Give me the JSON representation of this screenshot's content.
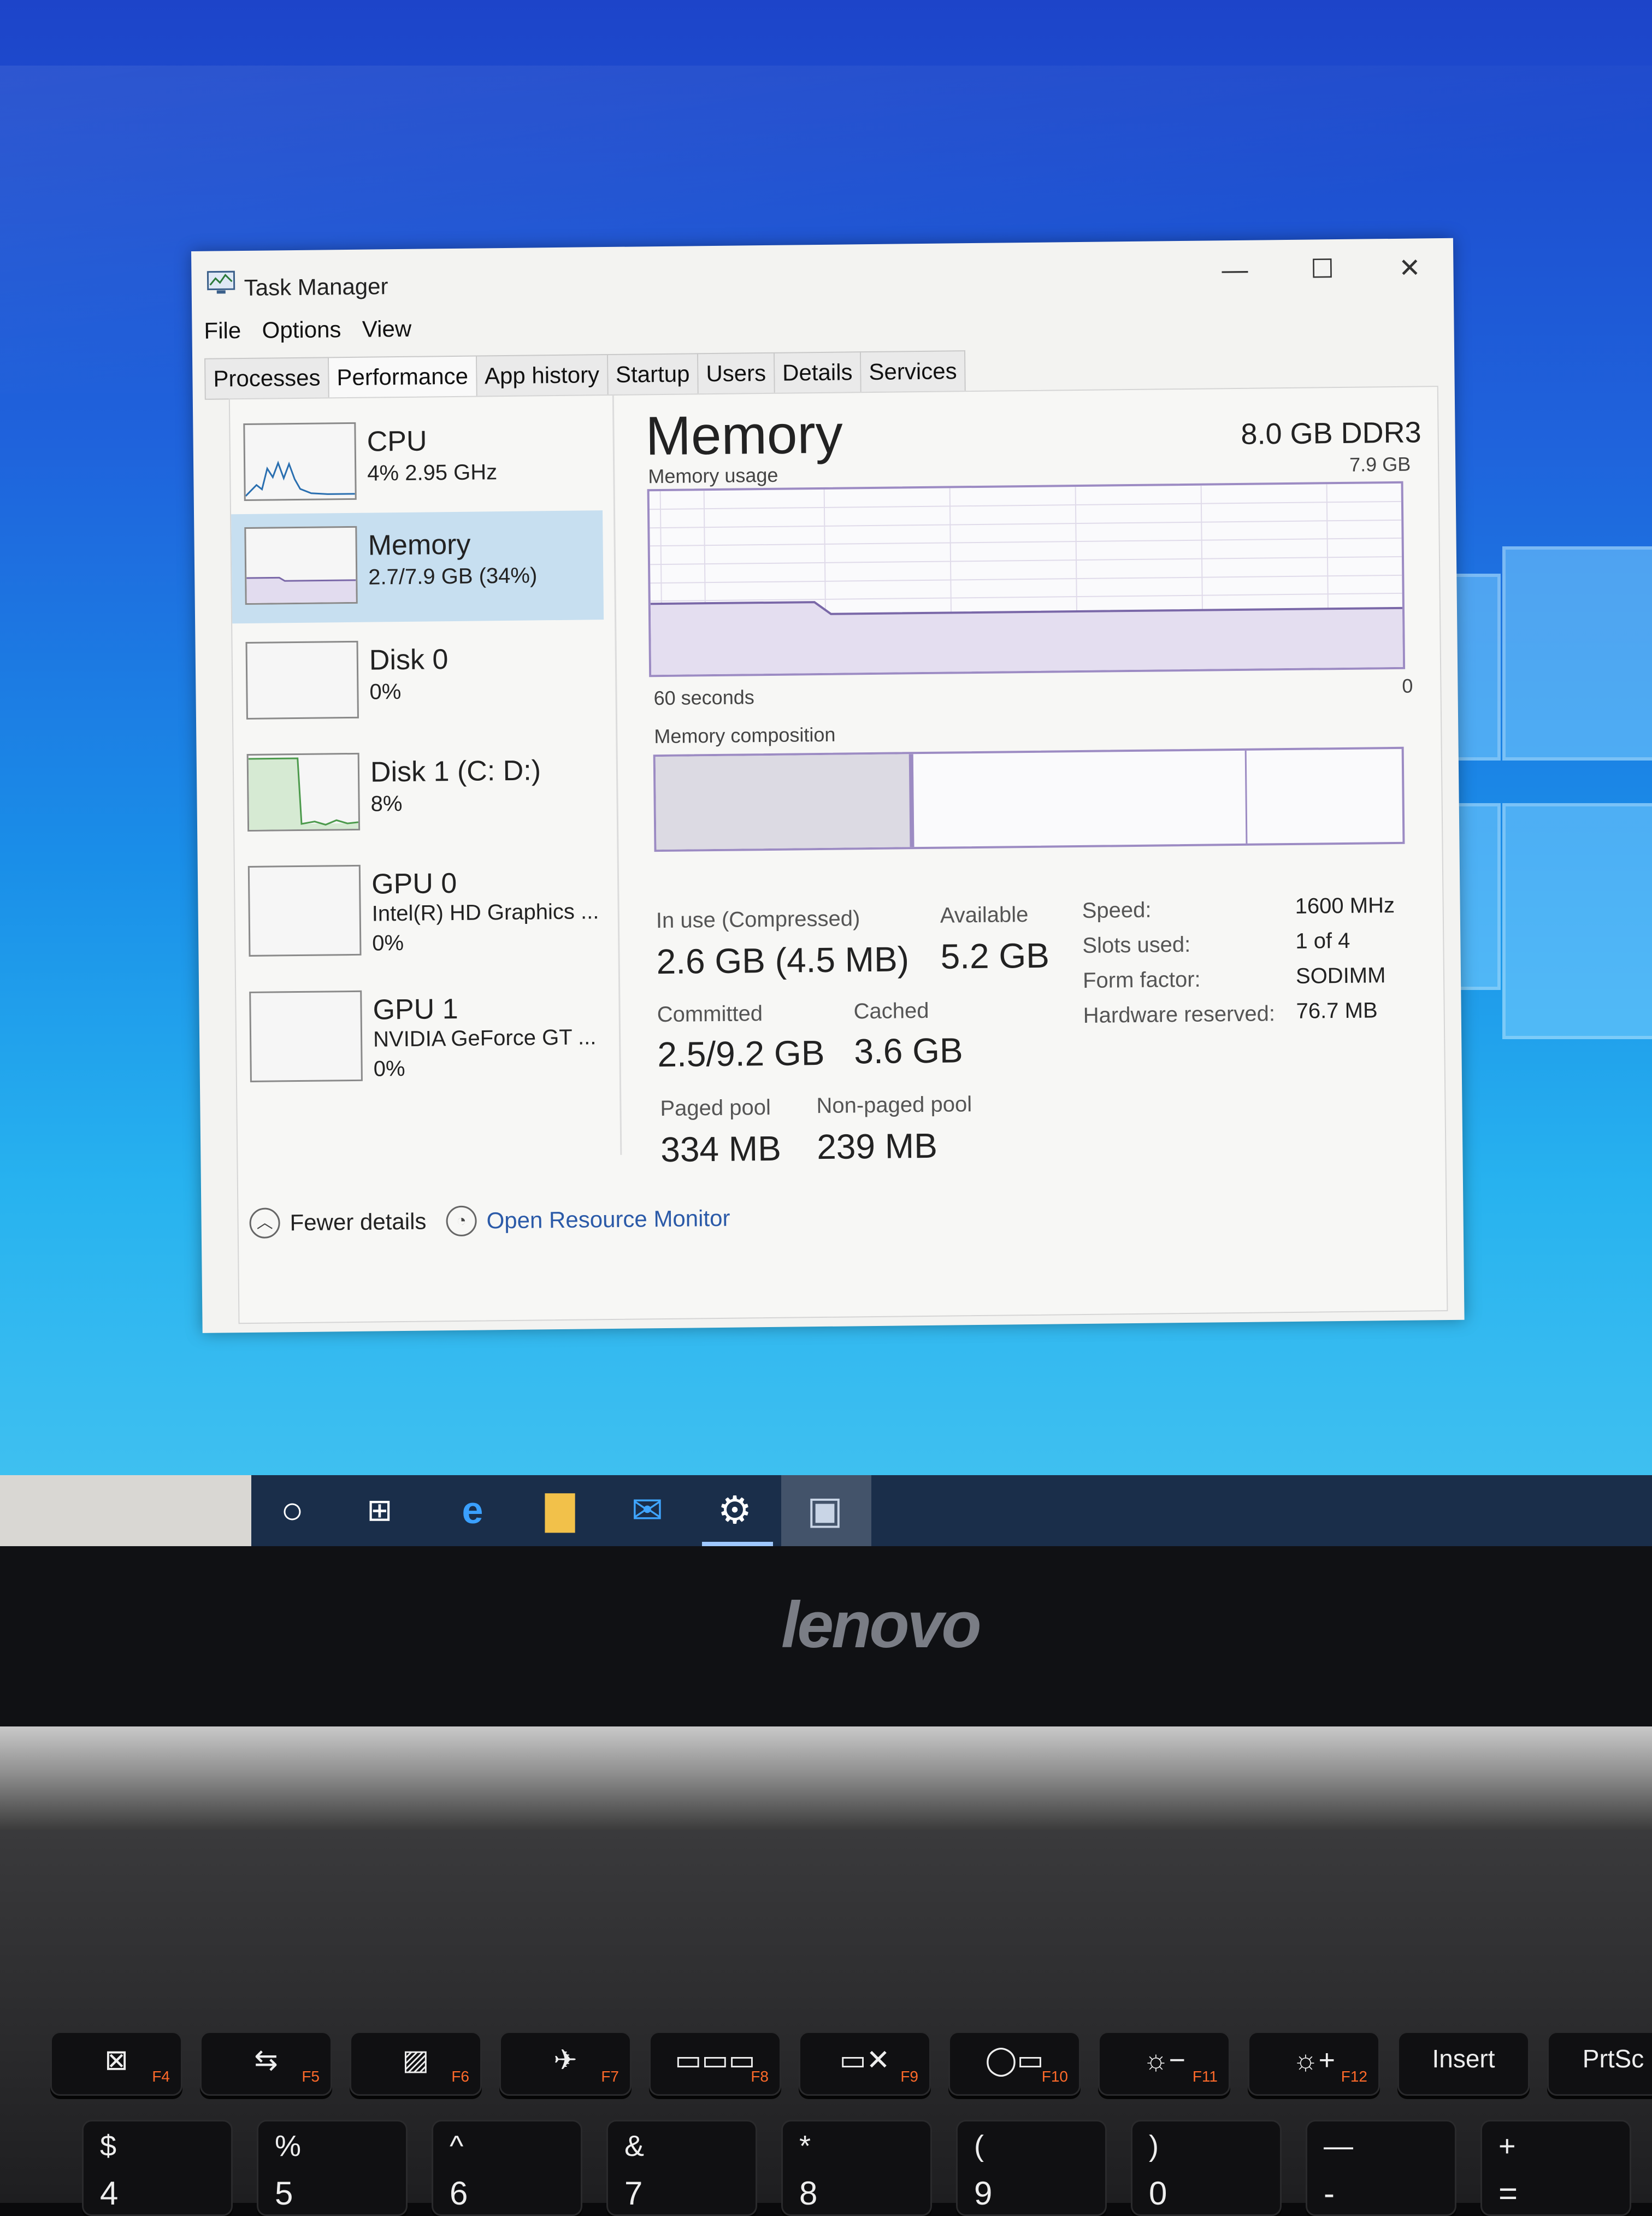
{
  "window": {
    "title": "Task Manager",
    "controls": {
      "minimize": "—",
      "maximize": "☐",
      "close": "✕"
    }
  },
  "menu": [
    "File",
    "Options",
    "View"
  ],
  "tabs": [
    "Processes",
    "Performance",
    "App history",
    "Startup",
    "Users",
    "Details",
    "Services"
  ],
  "active_tab": "Performance",
  "sidebar": [
    {
      "title": "CPU",
      "sub1": "4% 2.95 GHz"
    },
    {
      "title": "Memory",
      "sub1": "2.7/7.9 GB (34%)"
    },
    {
      "title": "Disk 0",
      "sub1": "0%"
    },
    {
      "title": "Disk 1 (C: D:)",
      "sub1": "8%"
    },
    {
      "title": "GPU 0",
      "sub1": "Intel(R) HD Graphics ...",
      "sub2": "0%"
    },
    {
      "title": "GPU 1",
      "sub1": "NVIDIA GeForce GT ...",
      "sub2": "0%"
    }
  ],
  "active_sidebar": "Memory",
  "main": {
    "title": "Memory",
    "hardware": "8.0 GB DDR3",
    "usage_label": "Memory usage",
    "usage_max": "7.9 GB",
    "time_label": "60 seconds",
    "zero_label": "0",
    "composition_label": "Memory composition",
    "composition_fractions": {
      "in_use": 0.34,
      "modified": 0.0,
      "standby": 0.45,
      "free": 0.21
    },
    "stats": {
      "in_use_label": "In use (Compressed)",
      "in_use_value": "2.6 GB (4.5 MB)",
      "available_label": "Available",
      "available_value": "5.2 GB",
      "committed_label": "Committed",
      "committed_value": "2.5/9.2 GB",
      "cached_label": "Cached",
      "cached_value": "3.6 GB",
      "paged_label": "Paged pool",
      "paged_value": "334 MB",
      "nonpaged_label": "Non-paged pool",
      "nonpaged_value": "239 MB"
    },
    "details": [
      {
        "label": "Speed:",
        "value": "1600 MHz"
      },
      {
        "label": "Slots used:",
        "value": "1 of 4"
      },
      {
        "label": "Form factor:",
        "value": "SODIMM"
      },
      {
        "label": "Hardware reserved:",
        "value": "76.7 MB"
      }
    ]
  },
  "footer": {
    "fewer": "Fewer details",
    "monitor": "Open Resource Monitor"
  },
  "taskbar_icons": [
    "cortana-icon",
    "task-view-icon",
    "edge-icon",
    "file-explorer-icon",
    "mail-icon",
    "settings-icon",
    "task-manager-icon"
  ],
  "brand": "lenovo",
  "keys": {
    "fn_row": [
      {
        "main": "⊠",
        "fn": "F4"
      },
      {
        "main": "⇆",
        "fn": "F5"
      },
      {
        "main": "▨",
        "fn": "F6"
      },
      {
        "main": "✈",
        "fn": "F7"
      },
      {
        "main": "▭▭▭",
        "fn": "F8"
      },
      {
        "main": "▭✕",
        "fn": "F9"
      },
      {
        "main": "◯▭",
        "fn": "F10"
      },
      {
        "main": "☼−",
        "fn": "F11"
      },
      {
        "main": "☼+",
        "fn": "F12"
      },
      {
        "main": "Insert",
        "fn": ""
      },
      {
        "main": "PrtSc",
        "fn": ""
      }
    ],
    "num_row": [
      {
        "top": "$",
        "bot": "4"
      },
      {
        "top": "%",
        "bot": "5"
      },
      {
        "top": "^",
        "bot": "6"
      },
      {
        "top": "&",
        "bot": "7"
      },
      {
        "top": "*",
        "bot": "8"
      },
      {
        "top": "(",
        "bot": "9"
      },
      {
        "top": ")",
        "bot": "0"
      },
      {
        "top": "—",
        "bot": "-"
      },
      {
        "top": "+",
        "bot": "="
      }
    ]
  },
  "colors": {
    "accent": "#9c8bc3",
    "selected": "#c7dff0",
    "disk_graph": "#5aa05a"
  }
}
